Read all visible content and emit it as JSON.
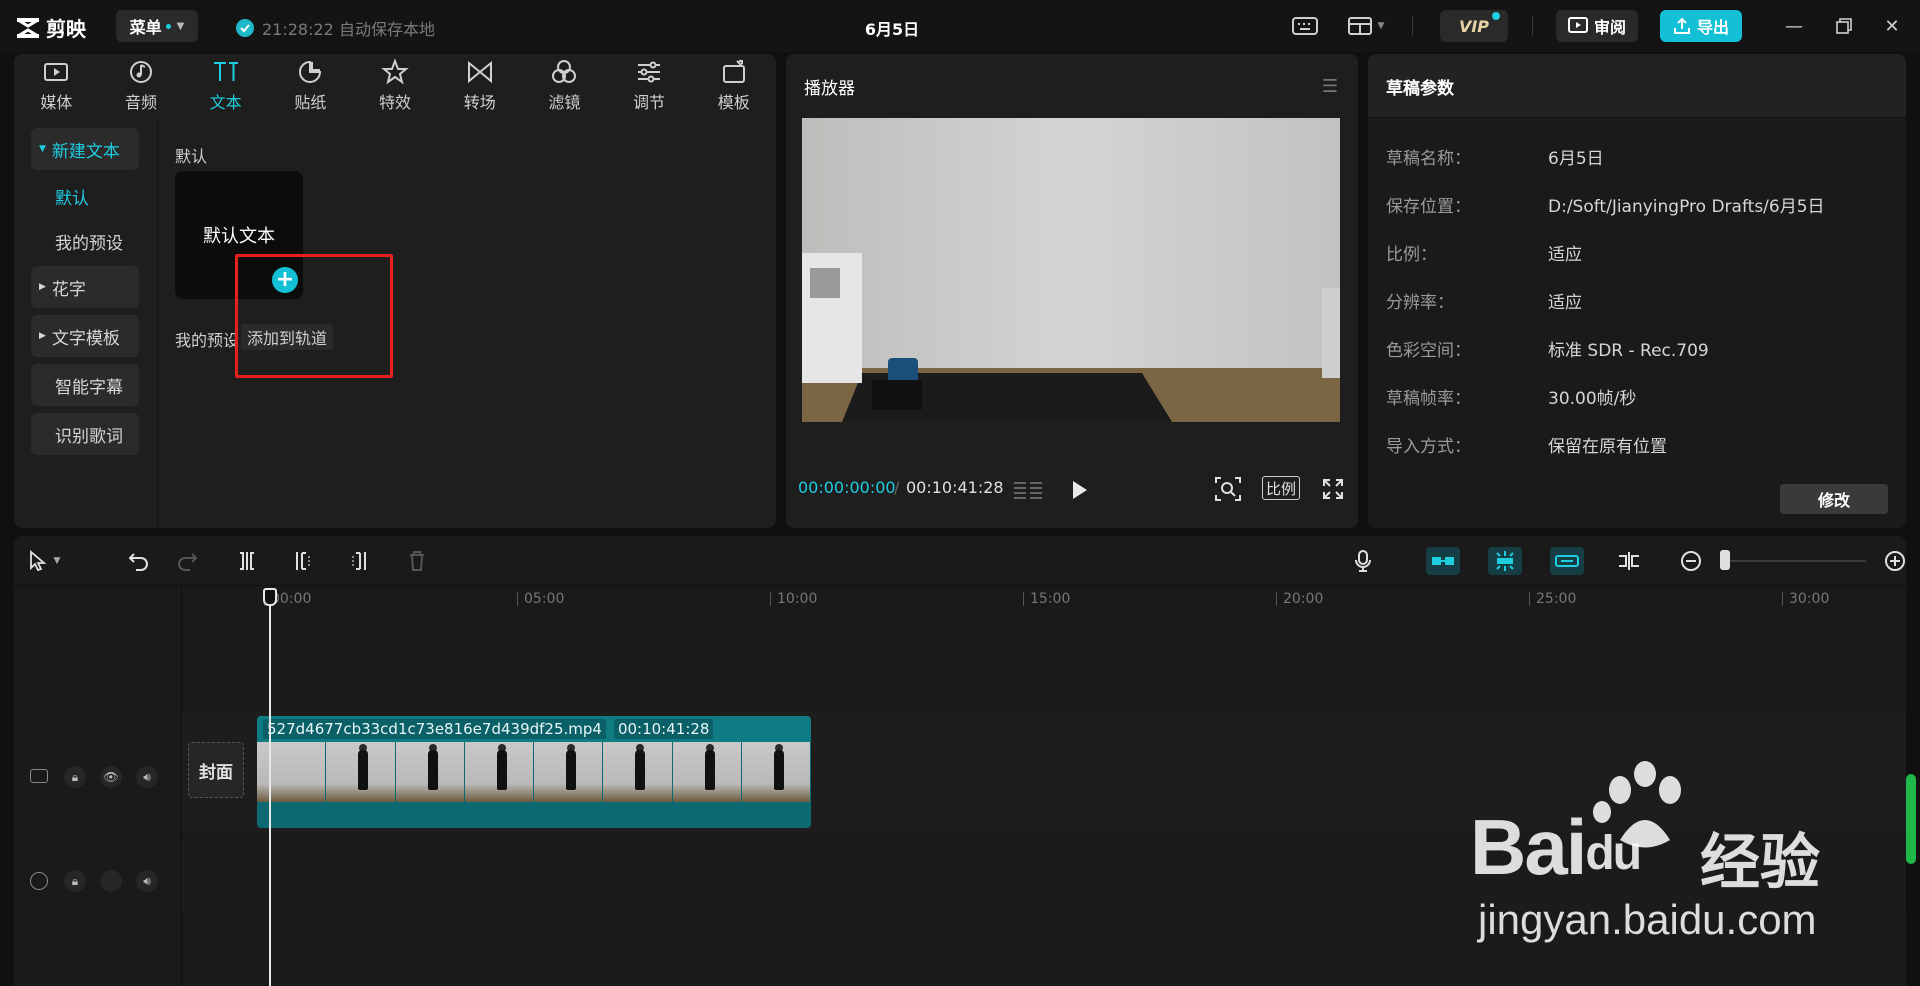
{
  "titlebar": {
    "app_name": "剪映",
    "menu_label": "菜单",
    "autosave_text": "21:28:22 自动保存本地",
    "project_title": "6月5日",
    "vip_label": "VIP",
    "review_label": "审阅",
    "export_label": "导出"
  },
  "media_tabs": [
    {
      "label": "媒体",
      "icon": "media-icon"
    },
    {
      "label": "音频",
      "icon": "audio-icon"
    },
    {
      "label": "文本",
      "icon": "text-icon",
      "active": true
    },
    {
      "label": "贴纸",
      "icon": "sticker-icon"
    },
    {
      "label": "特效",
      "icon": "effects-icon"
    },
    {
      "label": "转场",
      "icon": "transition-icon"
    },
    {
      "label": "滤镜",
      "icon": "filter-icon"
    },
    {
      "label": "调节",
      "icon": "adjust-icon"
    },
    {
      "label": "模板",
      "icon": "template-icon"
    }
  ],
  "text_sidebar": {
    "new_text": "新建文本",
    "default": "默认",
    "my_presets": "我的预设",
    "fancy_text": "花字",
    "text_template": "文字模板",
    "smart_caption": "智能字幕",
    "lyrics": "识别歌词"
  },
  "text_content": {
    "section_default": "默认",
    "default_card": "默认文本",
    "section_my_presets": "我的预设",
    "tooltip": "添加到轨道"
  },
  "player": {
    "title": "播放器",
    "current_time": "00:00:00:00",
    "separator": "/",
    "total_time": "00:10:41:28",
    "ratio_label": "比例"
  },
  "draft_params": {
    "title": "草稿参数",
    "rows": [
      {
        "label": "草稿名称：",
        "value": "6月5日"
      },
      {
        "label": "保存位置：",
        "value": "D:/Soft/JianyingPro Drafts/6月5日"
      },
      {
        "label": "比例：",
        "value": "适应"
      },
      {
        "label": "分辨率：",
        "value": "适应"
      },
      {
        "label": "色彩空间：",
        "value": "标准 SDR - Rec.709"
      },
      {
        "label": "草稿帧率：",
        "value": "30.00帧/秒"
      },
      {
        "label": "导入方式：",
        "value": "保留在原有位置"
      }
    ],
    "modify_label": "修改"
  },
  "timeline": {
    "ruler_ticks": [
      "00:00",
      "05:00",
      "10:00",
      "15:00",
      "20:00",
      "25:00",
      "30:00"
    ],
    "cover_label": "封面",
    "clip_name": "527d4677cb33cd1c73e816e7d439df25.mp4",
    "clip_duration": "00:10:41:28"
  },
  "watermark": {
    "brand": "Bai",
    "brand_du": "du",
    "brand_cn": "经验",
    "url": "jingyan.baidu.com"
  },
  "colors": {
    "accent": "#1fcde0",
    "export_bg": "#13c0d6",
    "highlight_box": "#e5201d",
    "clip": "#0d6a72"
  }
}
